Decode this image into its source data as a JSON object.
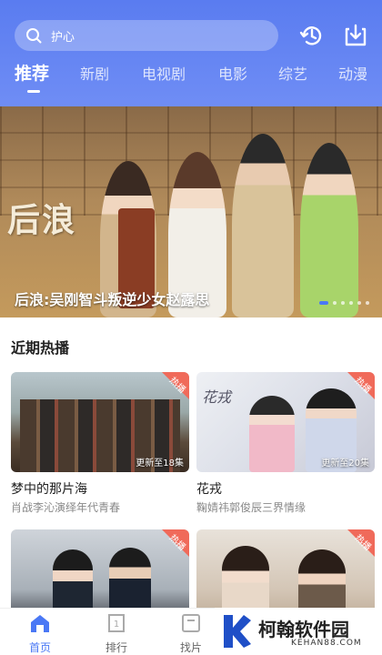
{
  "search": {
    "placeholder": "护心"
  },
  "header": {
    "icons": [
      "history-icon",
      "download-icon"
    ]
  },
  "tabs": [
    {
      "label": "推荐",
      "active": true
    },
    {
      "label": "新剧",
      "active": false
    },
    {
      "label": "电视剧",
      "active": false
    },
    {
      "label": "电影",
      "active": false
    },
    {
      "label": "综艺",
      "active": false
    },
    {
      "label": "动漫",
      "active": false
    }
  ],
  "banner": {
    "art_title": "后浪",
    "caption": "后浪:吴刚智斗叛逆少女赵露思",
    "slide_count": 6,
    "active_slide": 1
  },
  "section": {
    "title": "近期热播"
  },
  "cards": [
    {
      "title": "梦中的那片海",
      "subtitle": "肖战李沁演绎年代青春",
      "episode": "更新至18集",
      "tag": "热播"
    },
    {
      "title": "花戎",
      "subtitle": "鞠婧祎郭俊辰三界情缘",
      "episode": "更新至20集",
      "tag": "热播",
      "art_text": "花戎"
    },
    {
      "title": "",
      "subtitle": "",
      "episode": "",
      "tag": "热播"
    },
    {
      "title": "",
      "subtitle": "",
      "episode": "",
      "tag": "热播"
    }
  ],
  "bottom_nav": [
    {
      "label": "首页",
      "icon": "home-icon",
      "active": true
    },
    {
      "label": "排行",
      "icon": "ranking-icon",
      "active": false
    },
    {
      "label": "找片",
      "icon": "find-icon",
      "active": false
    }
  ],
  "watermark": {
    "text": "柯翰软件园",
    "url": "KEHAN88.COM"
  },
  "colors": {
    "accent": "#4a78f5",
    "header_bg": "#6080f2",
    "hot_tag": "#f06a5a"
  }
}
